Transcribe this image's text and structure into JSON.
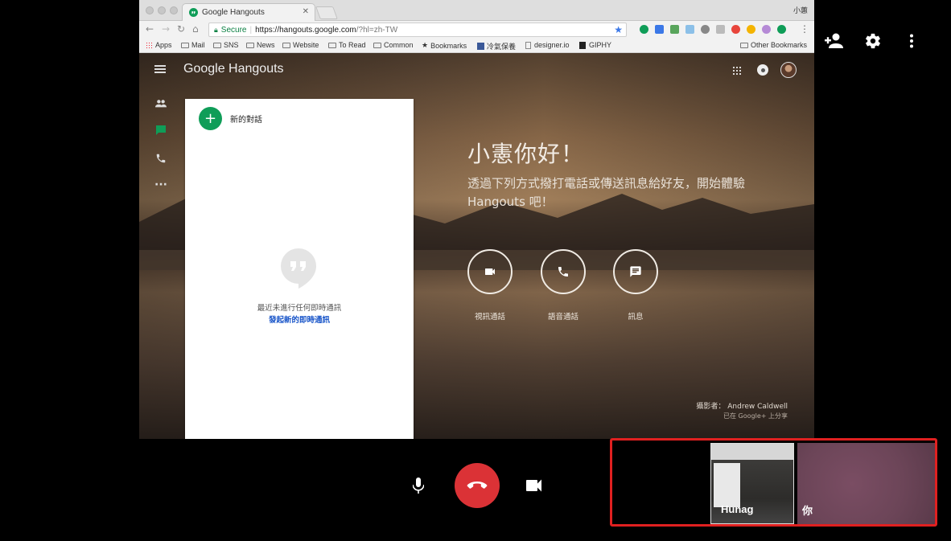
{
  "top_controls": {
    "add_person_icon": "person-add-icon",
    "settings_icon": "gear-icon",
    "more_icon": "more-vert-icon"
  },
  "browser": {
    "tab_title": "Google Hangouts",
    "tab_close": "✕",
    "profile_name": "小蕙",
    "secure_label": "Secure",
    "url_host": "https://hangouts.google.com",
    "url_path": "/?hl=zh-TW",
    "bookmarks": [
      "Apps",
      "Mail",
      "SNS",
      "News",
      "Website",
      "To Read",
      "Common",
      "Bookmarks",
      "冷氣保養",
      "designer.io",
      "GIPHY"
    ],
    "other_bookmarks": "Other Bookmarks"
  },
  "hangouts": {
    "app_title": "Google Hangouts",
    "new_conversation_label": "新的對話",
    "empty_state_text": "最近未進行任何即時通訊",
    "empty_state_link": "發起新的即時通訊",
    "greeting": "小憲你好！",
    "intro": "透過下列方式撥打電話或傳送訊息給好友，開始體驗 Hangouts 吧！",
    "actions": [
      {
        "label": "視訊通話",
        "icon": "videocam-icon"
      },
      {
        "label": "語音通話",
        "icon": "phone-icon"
      },
      {
        "label": "訊息",
        "icon": "message-icon"
      }
    ],
    "photo_credit": "攝影者： Andrew Caldwell",
    "photo_credit_sub": "已在 Google+ 上分享"
  },
  "call_controls": {
    "mic_icon": "mic-icon",
    "hangup_icon": "hangup-icon",
    "camera_icon": "videocam-icon"
  },
  "participants": [
    {
      "name": "Hunag"
    },
    {
      "name": "你"
    }
  ],
  "colors": {
    "hangup_red": "#db3236",
    "hangouts_green": "#0f9d58",
    "highlight_border": "#e02020",
    "link_blue": "#1a56c9"
  }
}
